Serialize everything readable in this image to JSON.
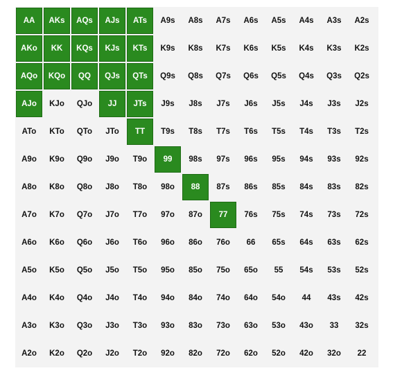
{
  "colors": {
    "grid_background": "#f3f3f3",
    "selected_fill": "#2a8a1f",
    "selected_border": "#1d6a14",
    "selected_text": "#ffffff",
    "unselected_text": "#111111"
  },
  "grid": {
    "rows": [
      [
        "AA",
        "AKs",
        "AQs",
        "AJs",
        "ATs",
        "A9s",
        "A8s",
        "A7s",
        "A6s",
        "A5s",
        "A4s",
        "A3s",
        "A2s"
      ],
      [
        "AKo",
        "KK",
        "KQs",
        "KJs",
        "KTs",
        "K9s",
        "K8s",
        "K7s",
        "K6s",
        "K5s",
        "K4s",
        "K3s",
        "K2s"
      ],
      [
        "AQo",
        "KQo",
        "QQ",
        "QJs",
        "QTs",
        "Q9s",
        "Q8s",
        "Q7s",
        "Q6s",
        "Q5s",
        "Q4s",
        "Q3s",
        "Q2s"
      ],
      [
        "AJo",
        "KJo",
        "QJo",
        "JJ",
        "JTs",
        "J9s",
        "J8s",
        "J7s",
        "J6s",
        "J5s",
        "J4s",
        "J3s",
        "J2s"
      ],
      [
        "ATo",
        "KTo",
        "QTo",
        "JTo",
        "TT",
        "T9s",
        "T8s",
        "T7s",
        "T6s",
        "T5s",
        "T4s",
        "T3s",
        "T2s"
      ],
      [
        "A9o",
        "K9o",
        "Q9o",
        "J9o",
        "T9o",
        "99",
        "98s",
        "97s",
        "96s",
        "95s",
        "94s",
        "93s",
        "92s"
      ],
      [
        "A8o",
        "K8o",
        "Q8o",
        "J8o",
        "T8o",
        "98o",
        "88",
        "87s",
        "86s",
        "85s",
        "84s",
        "83s",
        "82s"
      ],
      [
        "A7o",
        "K7o",
        "Q7o",
        "J7o",
        "T7o",
        "97o",
        "87o",
        "77",
        "76s",
        "75s",
        "74s",
        "73s",
        "72s"
      ],
      [
        "A6o",
        "K6o",
        "Q6o",
        "J6o",
        "T6o",
        "96o",
        "86o",
        "76o",
        "66",
        "65s",
        "64s",
        "63s",
        "62s"
      ],
      [
        "A5o",
        "K5o",
        "Q5o",
        "J5o",
        "T5o",
        "95o",
        "85o",
        "75o",
        "65o",
        "55",
        "54s",
        "53s",
        "52s"
      ],
      [
        "A4o",
        "K4o",
        "Q4o",
        "J4o",
        "T4o",
        "94o",
        "84o",
        "74o",
        "64o",
        "54o",
        "44",
        "43s",
        "42s"
      ],
      [
        "A3o",
        "K3o",
        "Q3o",
        "J3o",
        "T3o",
        "93o",
        "83o",
        "73o",
        "63o",
        "53o",
        "43o",
        "33",
        "32s"
      ],
      [
        "A2o",
        "K2o",
        "Q2o",
        "J2o",
        "T2o",
        "92o",
        "82o",
        "72o",
        "62o",
        "52o",
        "42o",
        "32o",
        "22"
      ]
    ],
    "selected": [
      "AA",
      "AKs",
      "AQs",
      "AJs",
      "ATs",
      "AKo",
      "KK",
      "KQs",
      "KJs",
      "KTs",
      "AQo",
      "KQo",
      "QQ",
      "QJs",
      "QTs",
      "AJo",
      "JJ",
      "JTs",
      "TT",
      "99",
      "88",
      "77"
    ]
  }
}
